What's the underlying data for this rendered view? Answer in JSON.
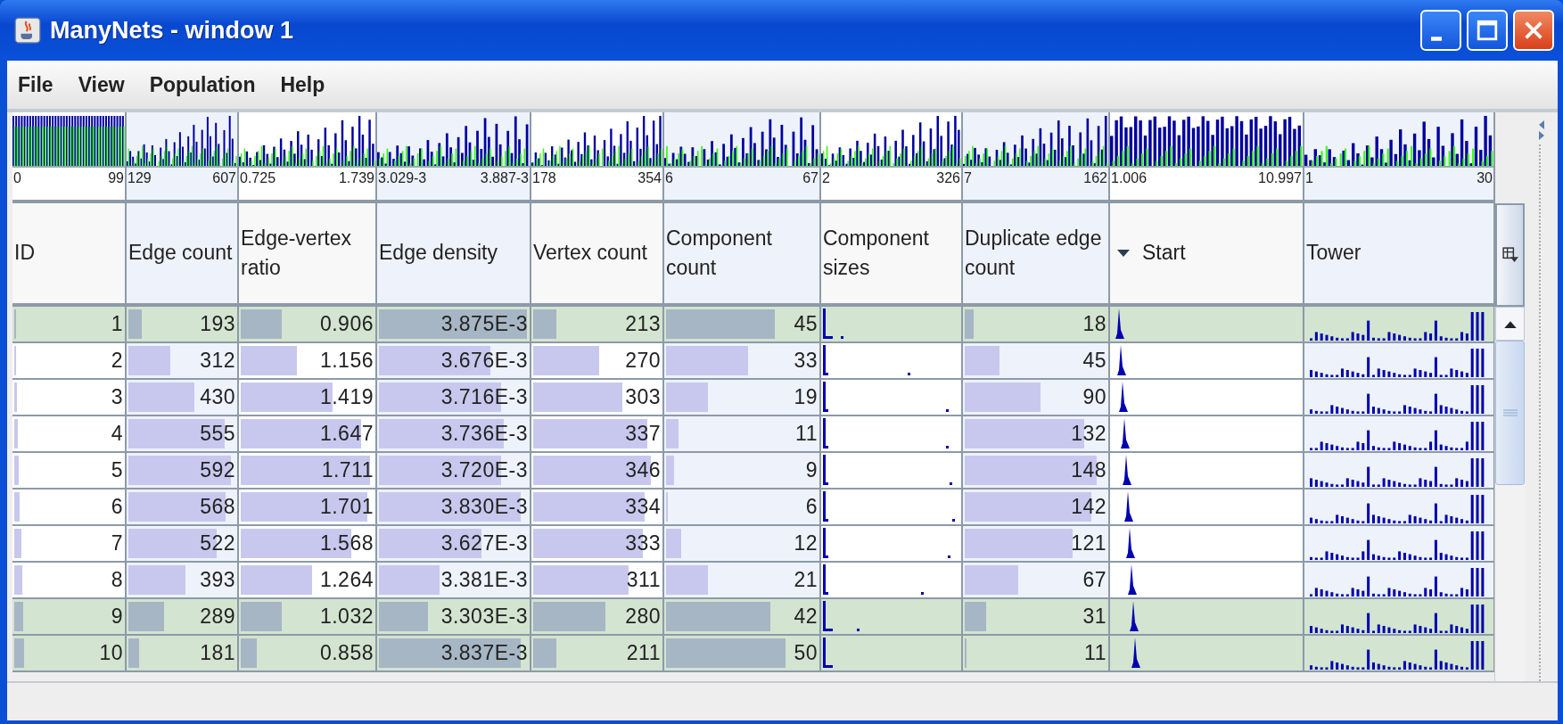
{
  "window": {
    "title": "ManyNets - window 1"
  },
  "menu": [
    {
      "label": "File"
    },
    {
      "label": "View"
    },
    {
      "label": "Population"
    },
    {
      "label": "Help"
    }
  ],
  "columns": [
    {
      "label": "ID",
      "kind": "number",
      "hist_min": "0",
      "hist_max": "99",
      "sorted": false
    },
    {
      "label": "Edge count",
      "kind": "number",
      "hist_min": "129",
      "hist_max": "607",
      "sorted": false
    },
    {
      "label": "Edge-vertex ratio",
      "kind": "number",
      "hist_min": "0.725",
      "hist_max": "1.739",
      "sorted": false
    },
    {
      "label": "Edge density",
      "kind": "number",
      "hist_min": "3.029-3",
      "hist_max": "3.887-3",
      "sorted": false
    },
    {
      "label": "Vertex count",
      "kind": "number",
      "hist_min": "178",
      "hist_max": "354",
      "sorted": false
    },
    {
      "label": "Component count",
      "kind": "number",
      "hist_min": "6",
      "hist_max": "67",
      "sorted": false
    },
    {
      "label": "Component sizes",
      "kind": "sizes",
      "hist_min": "2",
      "hist_max": "326",
      "sorted": false
    },
    {
      "label": "Duplicate edge count",
      "kind": "number",
      "hist_min": "7",
      "hist_max": "162",
      "sorted": false
    },
    {
      "label": "Start",
      "kind": "start",
      "hist_min": "1.006",
      "hist_max": "10.997",
      "sorted": true
    },
    {
      "label": "Tower",
      "kind": "tower",
      "hist_min": "1",
      "hist_max": "30",
      "sorted": false
    }
  ],
  "rows": [
    {
      "selected": true,
      "cells": [
        {
          "value": "1",
          "level": 0.0
        },
        {
          "value": "193",
          "level": 0.12
        },
        {
          "value": "0.906",
          "level": 0.3
        },
        {
          "value": "3.875E-3",
          "level": 0.97
        },
        {
          "value": "213",
          "level": 0.18
        },
        {
          "value": "45",
          "level": 0.7
        },
        {
          "value": "18",
          "level": 0.06
        }
      ]
    },
    {
      "selected": false,
      "cells": [
        {
          "value": "2",
          "level": 0.01
        },
        {
          "value": "312",
          "level": 0.38
        },
        {
          "value": "1.156",
          "level": 0.41
        },
        {
          "value": "3.676E-3",
          "level": 0.73
        },
        {
          "value": "270",
          "level": 0.5
        },
        {
          "value": "33",
          "level": 0.53
        },
        {
          "value": "45",
          "level": 0.24
        }
      ]
    },
    {
      "selected": false,
      "cells": [
        {
          "value": "3",
          "level": 0.02
        },
        {
          "value": "430",
          "level": 0.6
        },
        {
          "value": "1.419",
          "level": 0.67
        },
        {
          "value": "3.716E-3",
          "level": 0.8
        },
        {
          "value": "303",
          "level": 0.68
        },
        {
          "value": "19",
          "level": 0.27
        },
        {
          "value": "90",
          "level": 0.52
        }
      ]
    },
    {
      "selected": false,
      "cells": [
        {
          "value": "4",
          "level": 0.03
        },
        {
          "value": "555",
          "level": 0.87
        },
        {
          "value": "1.647",
          "level": 0.88
        },
        {
          "value": "3.736E-3",
          "level": 0.82
        },
        {
          "value": "337",
          "level": 0.87
        },
        {
          "value": "11",
          "level": 0.08
        },
        {
          "value": "132",
          "level": 0.82
        }
      ]
    },
    {
      "selected": false,
      "cells": [
        {
          "value": "5",
          "level": 0.04
        },
        {
          "value": "592",
          "level": 0.93
        },
        {
          "value": "1.711",
          "level": 0.95
        },
        {
          "value": "3.720E-3",
          "level": 0.8
        },
        {
          "value": "346",
          "level": 0.9
        },
        {
          "value": "9",
          "level": 0.05
        },
        {
          "value": "148",
          "level": 0.91
        }
      ]
    },
    {
      "selected": false,
      "cells": [
        {
          "value": "6",
          "level": 0.05
        },
        {
          "value": "568",
          "level": 0.88
        },
        {
          "value": "1.701",
          "level": 0.93
        },
        {
          "value": "3.830E-3",
          "level": 0.93
        },
        {
          "value": "334",
          "level": 0.85
        },
        {
          "value": "6",
          "level": 0.0
        },
        {
          "value": "142",
          "level": 0.87
        }
      ]
    },
    {
      "selected": false,
      "cells": [
        {
          "value": "7",
          "level": 0.06
        },
        {
          "value": "522",
          "level": 0.8
        },
        {
          "value": "1.568",
          "level": 0.81
        },
        {
          "value": "3.627E-3",
          "level": 0.67
        },
        {
          "value": "333",
          "level": 0.84
        },
        {
          "value": "12",
          "level": 0.1
        },
        {
          "value": "121",
          "level": 0.74
        }
      ]
    },
    {
      "selected": false,
      "cells": [
        {
          "value": "8",
          "level": 0.07
        },
        {
          "value": "393",
          "level": 0.52
        },
        {
          "value": "1.264",
          "level": 0.52
        },
        {
          "value": "3.381E-3",
          "level": 0.4
        },
        {
          "value": "311",
          "level": 0.73
        },
        {
          "value": "21",
          "level": 0.27
        },
        {
          "value": "67",
          "level": 0.37
        }
      ]
    },
    {
      "selected": true,
      "cells": [
        {
          "value": "9",
          "level": 0.08
        },
        {
          "value": "289",
          "level": 0.32
        },
        {
          "value": "1.032",
          "level": 0.3
        },
        {
          "value": "3.303E-3",
          "level": 0.32
        },
        {
          "value": "280",
          "level": 0.55
        },
        {
          "value": "42",
          "level": 0.67
        },
        {
          "value": "31",
          "level": 0.15
        }
      ]
    },
    {
      "selected": true,
      "cells": [
        {
          "value": "10",
          "level": 0.09
        },
        {
          "value": "181",
          "level": 0.1
        },
        {
          "value": "0.858",
          "level": 0.12
        },
        {
          "value": "3.837E-3",
          "level": 0.93
        },
        {
          "value": "211",
          "level": 0.18
        },
        {
          "value": "50",
          "level": 0.77
        },
        {
          "value": "11",
          "level": 0.01
        }
      ]
    }
  ]
}
